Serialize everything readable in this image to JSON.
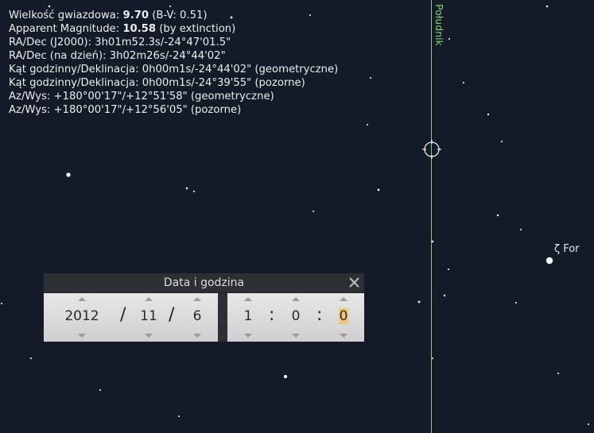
{
  "info": {
    "line1": {
      "label": "Wielkość gwiazdowa: ",
      "value": "9.70",
      "suffix": " (B-V: 0.51)"
    },
    "line2": {
      "label": "Apparent Magnitude: ",
      "value": "10.58",
      "suffix": " (by extinction)"
    },
    "line3": "RA/Dec (J2000): 3h01m52.3s/-24°47'01.5\"",
    "line4": "RA/Dec (na dzień): 3h02m26s/-24°44'02\"",
    "line5": "Kąt godzinny/Deklinacja: 0h00m1s/-24°44'02\" (geometryczne)",
    "line6": "Kąt godzinny/Deklinacja: 0h00m1s/-24°39'55\" (pozorne)",
    "line7": "Az/Wys: +180°00'17\"/+12°51'58\" (geometryczne)",
    "line8": "Az/Wys: +180°00'17\"/+12°56'05\" (pozorne)"
  },
  "meridian_label": "Południk",
  "star_label": "ζ For",
  "colors": {
    "meridian": "#7ed36c",
    "sky": "#141a28",
    "highlight": "#f2c47c"
  },
  "dialog": {
    "title": "Data i godzina",
    "close_icon": "close-icon",
    "date": {
      "year": "2012",
      "month": "11",
      "day": "6",
      "separator": "/"
    },
    "time": {
      "hour": "1",
      "minute": "0",
      "second": "0",
      "separator": ":"
    }
  }
}
